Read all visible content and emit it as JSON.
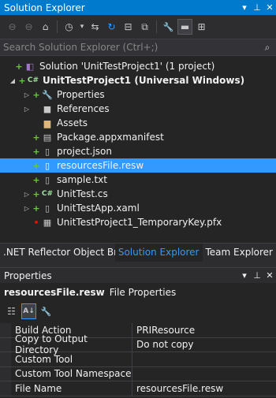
{
  "solution_explorer": {
    "title": "Solution Explorer",
    "window_buttons": [
      "▾",
      "⊥",
      "✕"
    ],
    "toolbar": [
      {
        "name": "back-icon",
        "glyph": "⊖"
      },
      {
        "name": "forward-icon",
        "glyph": "⊖"
      },
      {
        "name": "home-icon",
        "glyph": "⌂"
      },
      {
        "name": "history-icon",
        "glyph": "◷"
      },
      {
        "name": "dropdown-icon",
        "glyph": "▾"
      },
      {
        "name": "sync-icon",
        "glyph": "⇆"
      },
      {
        "name": "refresh-icon",
        "glyph": "↻"
      },
      {
        "name": "collapse-all-icon",
        "glyph": "⊟"
      },
      {
        "name": "show-all-files-icon",
        "glyph": "⧉"
      },
      {
        "name": "properties-wrench-icon",
        "glyph": "🔧"
      },
      {
        "name": "preview-icon",
        "glyph": "▬"
      },
      {
        "name": "class-view-icon",
        "glyph": "⊞"
      }
    ],
    "search_placeholder": "Search Solution Explorer (Ctrl+;)",
    "search_icon": "⌕"
  },
  "tree": [
    {
      "name": "solution-node",
      "indent": 0,
      "exp": "",
      "ind": "+",
      "ind_color": "plus",
      "icon": "◧",
      "icon_color": "#a074c4",
      "label": "Solution 'UnitTestProject1' (1 project)",
      "bold": false,
      "selected": false
    },
    {
      "name": "project-node",
      "indent": 1,
      "exp": "◢",
      "ind": "+",
      "ind_color": "plus",
      "icon": "C#",
      "icon_color": "#9be29b",
      "label": "UnitTestProject1 (Universal Windows)",
      "bold": true,
      "selected": false
    },
    {
      "name": "properties-node",
      "indent": 2,
      "exp": "▷",
      "ind": "+",
      "ind_color": "plus",
      "icon": "🔧",
      "icon_color": "#c8c8c8",
      "label": "Properties",
      "bold": false,
      "selected": false
    },
    {
      "name": "references-node",
      "indent": 2,
      "exp": "▷",
      "ind": "",
      "ind_color": "",
      "icon": "■",
      "icon_color": "#c8c8c8",
      "label": "References",
      "bold": false,
      "selected": false
    },
    {
      "name": "assets-node",
      "indent": 2,
      "exp": "",
      "ind": "",
      "ind_color": "",
      "icon": "▆",
      "icon_color": "#dcb67a",
      "label": "Assets",
      "bold": false,
      "selected": false
    },
    {
      "name": "manifest-node",
      "indent": 2,
      "exp": "",
      "ind": "+",
      "ind_color": "plus",
      "icon": "▤",
      "icon_color": "#c8c8c8",
      "label": "Package.appxmanifest",
      "bold": false,
      "selected": false
    },
    {
      "name": "project-json-node",
      "indent": 2,
      "exp": "",
      "ind": "+",
      "ind_color": "plus",
      "icon": "▯",
      "icon_color": "#c8c8c8",
      "label": "project.json",
      "bold": false,
      "selected": false
    },
    {
      "name": "resources-file-node",
      "indent": 2,
      "exp": "",
      "ind": "+",
      "ind_color": "plus",
      "icon": "▯",
      "icon_color": "#ffffff",
      "label": "resourcesFile.resw",
      "bold": false,
      "selected": true
    },
    {
      "name": "sample-txt-node",
      "indent": 2,
      "exp": "",
      "ind": "+",
      "ind_color": "plus",
      "icon": "▯",
      "icon_color": "#c8c8c8",
      "label": "sample.txt",
      "bold": false,
      "selected": false
    },
    {
      "name": "unittest-cs-node",
      "indent": 2,
      "exp": "▷",
      "ind": "+",
      "ind_color": "plus",
      "icon": "C#",
      "icon_color": "#9be29b",
      "label": "UnitTest.cs",
      "bold": false,
      "selected": false
    },
    {
      "name": "unittestapp-xaml-node",
      "indent": 2,
      "exp": "▷",
      "ind": "+",
      "ind_color": "plus",
      "icon": "▯",
      "icon_color": "#c8c8c8",
      "label": "UnitTestApp.xaml",
      "bold": false,
      "selected": false
    },
    {
      "name": "temporary-key-node",
      "indent": 2,
      "exp": "",
      "ind": "•",
      "ind_color": "red",
      "icon": "▦",
      "icon_color": "#c8c8c8",
      "label": "UnitTestProject1_TemporaryKey.pfx",
      "bold": false,
      "selected": false
    }
  ],
  "tabs": [
    {
      "name": "tab-net-reflector",
      "label": ".NET Reflector Object Brows...",
      "active": false
    },
    {
      "name": "tab-solution-explorer",
      "label": "Solution Explorer",
      "active": true
    },
    {
      "name": "tab-team-explorer",
      "label": "Team Explorer",
      "active": false
    }
  ],
  "properties": {
    "title": "Properties",
    "window_buttons": [
      "▾",
      "⊥",
      "✕"
    ],
    "object_name": "resourcesFile.resw",
    "object_type": "File Properties",
    "toolbar": [
      {
        "name": "categorized-icon",
        "glyph": "☷",
        "active": false
      },
      {
        "name": "alphabetical-icon",
        "glyph": "A↓",
        "active": true
      },
      {
        "name": "property-pages-icon",
        "glyph": "🔧",
        "active": false
      }
    ],
    "rows": [
      {
        "name": "Build Action",
        "value": "PRIResource"
      },
      {
        "name": "Copy to Output Directory",
        "value": "Do not copy"
      },
      {
        "name": "Custom Tool",
        "value": ""
      },
      {
        "name": "Custom Tool Namespace",
        "value": ""
      },
      {
        "name": "File Name",
        "value": "resourcesFile.resw"
      }
    ]
  },
  "colors": {
    "accent": "#007acc",
    "selection": "#3399ff",
    "background": "#252526",
    "chrome": "#2d2d30"
  }
}
